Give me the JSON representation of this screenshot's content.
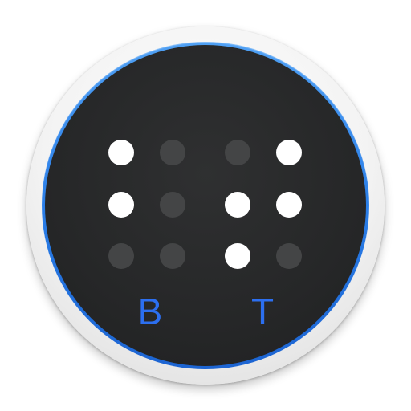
{
  "icon": {
    "colors": {
      "ring_outer": "#f3f3f3",
      "ring_accent": "#2a7ee8",
      "face": "#262728",
      "dot_raised": "#ffffff",
      "dot_flat": "#444546",
      "letter": "#2c6ff0"
    },
    "braille_cells": [
      {
        "letter": "B",
        "dots": [
          {
            "id": 1,
            "raised": true
          },
          {
            "id": 4,
            "raised": false
          },
          {
            "id": 2,
            "raised": true
          },
          {
            "id": 5,
            "raised": false
          },
          {
            "id": 3,
            "raised": false
          },
          {
            "id": 6,
            "raised": false
          }
        ]
      },
      {
        "letter": "T",
        "dots": [
          {
            "id": 1,
            "raised": false
          },
          {
            "id": 4,
            "raised": true
          },
          {
            "id": 2,
            "raised": true
          },
          {
            "id": 5,
            "raised": true
          },
          {
            "id": 3,
            "raised": true
          },
          {
            "id": 6,
            "raised": false
          }
        ]
      }
    ]
  }
}
